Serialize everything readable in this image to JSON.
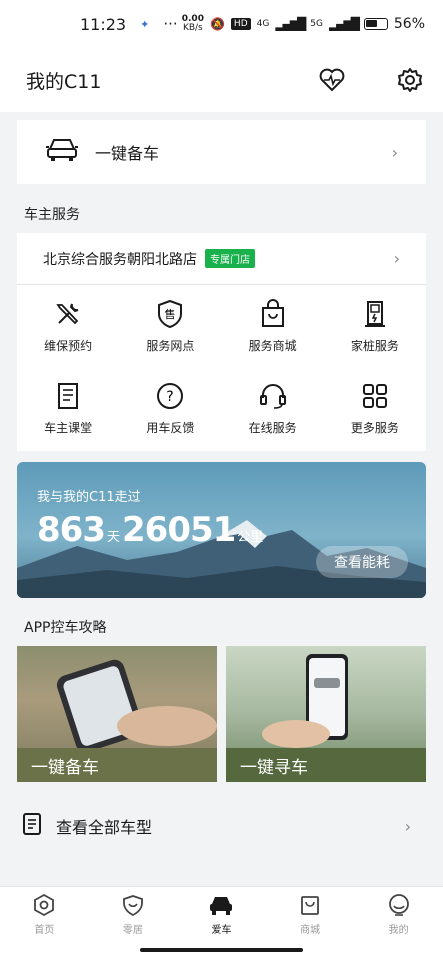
{
  "status": {
    "time": "11:23",
    "net_speed": "0.00",
    "net_unit": "KB/s",
    "hd": "HD",
    "sig1": "4G",
    "sig2": "5G",
    "battery": "56%"
  },
  "header": {
    "title": "我的C11"
  },
  "backup_card": {
    "label": "一键备车"
  },
  "owner_service": {
    "section_title": "车主服务",
    "store_name": "北京综合服务朝阳北路店",
    "store_tag": "专属门店",
    "items": [
      {
        "label": "维保预约",
        "icon": "wrench-icon"
      },
      {
        "label": "服务网点",
        "icon": "shield-service-icon"
      },
      {
        "label": "服务商城",
        "icon": "shopping-bag-icon"
      },
      {
        "label": "家桩服务",
        "icon": "charger-icon"
      },
      {
        "label": "车主课堂",
        "icon": "book-icon"
      },
      {
        "label": "用车反馈",
        "icon": "help-icon"
      },
      {
        "label": "在线服务",
        "icon": "headset-icon"
      },
      {
        "label": "更多服务",
        "icon": "grid-icon"
      }
    ]
  },
  "mileage": {
    "subtitle": "我与我的C11走过",
    "days": "863",
    "days_unit": "天",
    "km": "26051",
    "km_unit": "公里",
    "button": "查看能耗"
  },
  "guides": {
    "section_title": "APP控车攻略",
    "items": [
      {
        "label": "一键备车"
      },
      {
        "label": "一键寻车"
      }
    ]
  },
  "all_models": {
    "label": "查看全部车型"
  },
  "tabbar": {
    "items": [
      {
        "label": "首页",
        "icon": "home-hex-icon",
        "active": false
      },
      {
        "label": "零居",
        "icon": "heart-shield-icon",
        "active": false
      },
      {
        "label": "爱车",
        "icon": "car-icon",
        "active": true
      },
      {
        "label": "商城",
        "icon": "bag-icon",
        "active": false
      },
      {
        "label": "我的",
        "icon": "profile-icon",
        "active": false
      }
    ]
  },
  "colors": {
    "tag_green": "#19b14c",
    "background": "#f2f3f5"
  }
}
